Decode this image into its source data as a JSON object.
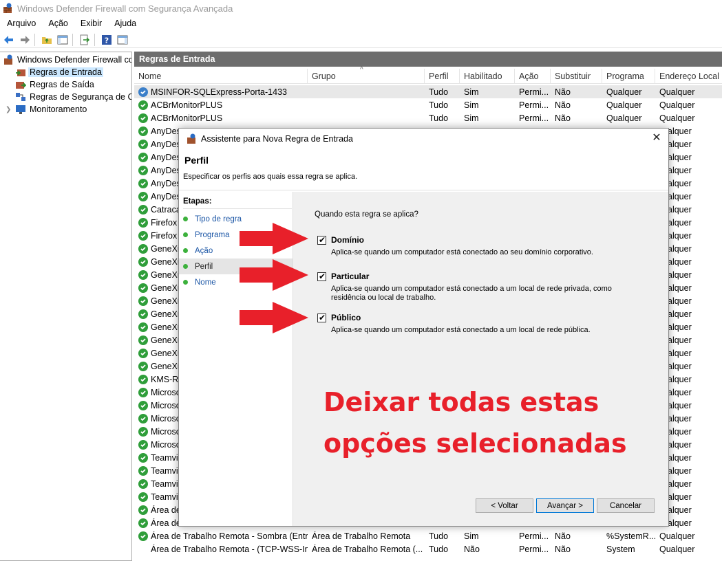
{
  "window": {
    "title": "Windows Defender Firewall com Segurança Avançada"
  },
  "menu": [
    "Arquivo",
    "Ação",
    "Exibir",
    "Ajuda"
  ],
  "tree": {
    "items": [
      {
        "label": "Windows Defender Firewall cor",
        "level": 0
      },
      {
        "label": "Regras de Entrada",
        "level": 1,
        "selected": true
      },
      {
        "label": "Regras de Saída",
        "level": 1
      },
      {
        "label": "Regras de Segurança de Co",
        "level": 1
      },
      {
        "label": "Monitoramento",
        "level": 1
      }
    ]
  },
  "pane": {
    "header": "Regras de Entrada",
    "columns": [
      "Nome",
      "Grupo",
      "Perfil",
      "Habilitado",
      "Ação",
      "Substituir",
      "Programa",
      "Endereço Local"
    ],
    "rows": [
      {
        "icon": "globe",
        "name": "MSINFOR-SQLExpress-Porta-1433",
        "group": "",
        "profile": "Tudo",
        "enabled": "Sim",
        "action": "Permi...",
        "override": "Não",
        "program": "Qualquer",
        "local": "Qualquer"
      },
      {
        "icon": "check",
        "name": "ACBrMonitorPLUS",
        "group": "",
        "profile": "Tudo",
        "enabled": "Sim",
        "action": "Permi...",
        "override": "Não",
        "program": "Qualquer",
        "local": "Qualquer"
      },
      {
        "icon": "check",
        "name": "ACBrMonitorPLUS",
        "group": "",
        "profile": "Tudo",
        "enabled": "Sim",
        "action": "Permi...",
        "override": "Não",
        "program": "Qualquer",
        "local": "Qualquer"
      },
      {
        "icon": "check",
        "name": "AnyDes",
        "local": "alquer"
      },
      {
        "icon": "check",
        "name": "AnyDes",
        "local": "alquer"
      },
      {
        "icon": "check",
        "name": "AnyDes",
        "local": "alquer"
      },
      {
        "icon": "check",
        "name": "AnyDes",
        "local": "alquer"
      },
      {
        "icon": "check",
        "name": "AnyDes",
        "local": "alquer"
      },
      {
        "icon": "check",
        "name": "AnyDes",
        "local": "alquer"
      },
      {
        "icon": "check",
        "name": "Catraca",
        "local": "alquer"
      },
      {
        "icon": "check",
        "name": "Firefox (",
        "local": "alquer"
      },
      {
        "icon": "check",
        "name": "Firefox (",
        "local": "alquer"
      },
      {
        "icon": "check",
        "name": "GeneXu",
        "local": "alquer"
      },
      {
        "icon": "check",
        "name": "GeneXu",
        "local": "alquer"
      },
      {
        "icon": "check",
        "name": "GeneXu",
        "local": "alquer"
      },
      {
        "icon": "check",
        "name": "GeneXu",
        "local": "alquer"
      },
      {
        "icon": "check",
        "name": "GeneXu",
        "local": "alquer"
      },
      {
        "icon": "check",
        "name": "GeneXu",
        "local": "alquer"
      },
      {
        "icon": "check",
        "name": "GeneXu",
        "local": "alquer"
      },
      {
        "icon": "check",
        "name": "GeneXu",
        "local": "alquer"
      },
      {
        "icon": "check",
        "name": "GeneXu",
        "local": "alquer"
      },
      {
        "icon": "check",
        "name": "GeneXu",
        "local": "alquer"
      },
      {
        "icon": "check",
        "name": "KMS-R",
        "local": "alquer"
      },
      {
        "icon": "check",
        "name": "Microso",
        "local": "alquer"
      },
      {
        "icon": "check",
        "name": "Microso",
        "local": "alquer"
      },
      {
        "icon": "check",
        "name": "Microso",
        "local": "alquer"
      },
      {
        "icon": "check",
        "name": "Microso",
        "local": "alquer"
      },
      {
        "icon": "check",
        "name": "Microso",
        "local": "alquer"
      },
      {
        "icon": "check",
        "name": "Teamvi",
        "local": "alquer"
      },
      {
        "icon": "check",
        "name": "Teamvi",
        "local": "alquer"
      },
      {
        "icon": "check",
        "name": "Teamvi",
        "local": "alquer"
      },
      {
        "icon": "check",
        "name": "Teamvi",
        "local": "alquer"
      },
      {
        "icon": "check",
        "name": "Área de",
        "local": "alquer"
      },
      {
        "icon": "check",
        "name": "Área de",
        "local": "alquer"
      },
      {
        "icon": "check",
        "name": "Área de Trabalho Remota - Sombra (Entr...",
        "group": "Área de Trabalho Remota",
        "profile": "Tudo",
        "enabled": "Sim",
        "action": "Permi...",
        "override": "Não",
        "program": "%SystemR...",
        "local": "Qualquer"
      },
      {
        "icon": "none",
        "name": "Área de Trabalho Remota - (TCP-WSS-In)",
        "group": "Área de Trabalho Remota (...",
        "profile": "Tudo",
        "enabled": "Não",
        "action": "Permi...",
        "override": "Não",
        "program": "System",
        "local": "Qualquer"
      }
    ]
  },
  "dialog": {
    "title": "Assistente para Nova Regra de Entrada",
    "heading": "Perfil",
    "subheading": "Especificar os perfis aos quais essa regra se aplica.",
    "steps_title": "Etapas:",
    "steps": [
      {
        "label": "Tipo de regra",
        "active": false
      },
      {
        "label": "Programa",
        "active": false
      },
      {
        "label": "Ação",
        "active": false
      },
      {
        "label": "Perfil",
        "active": true
      },
      {
        "label": "Nome",
        "active": false
      }
    ],
    "question": "Quando esta regra se aplica?",
    "options": [
      {
        "title": "Domínio",
        "desc": "Aplica-se quando um computador está conectado ao seu domínio corporativo.",
        "checked": true
      },
      {
        "title": "Particular",
        "desc": "Aplica-se quando um computador está conectado a um local de rede privada, como residência ou local de trabalho.",
        "checked": true
      },
      {
        "title": "Público",
        "desc": "Aplica-se quando um computador está conectado a um local de rede pública.",
        "checked": true
      }
    ],
    "buttons": {
      "back": "< Voltar",
      "next": "Avançar >",
      "cancel": "Cancelar"
    }
  },
  "annotation": {
    "line1": "Deixar todas estas",
    "line2": "opções selecionadas",
    "color": "#e8202a"
  }
}
